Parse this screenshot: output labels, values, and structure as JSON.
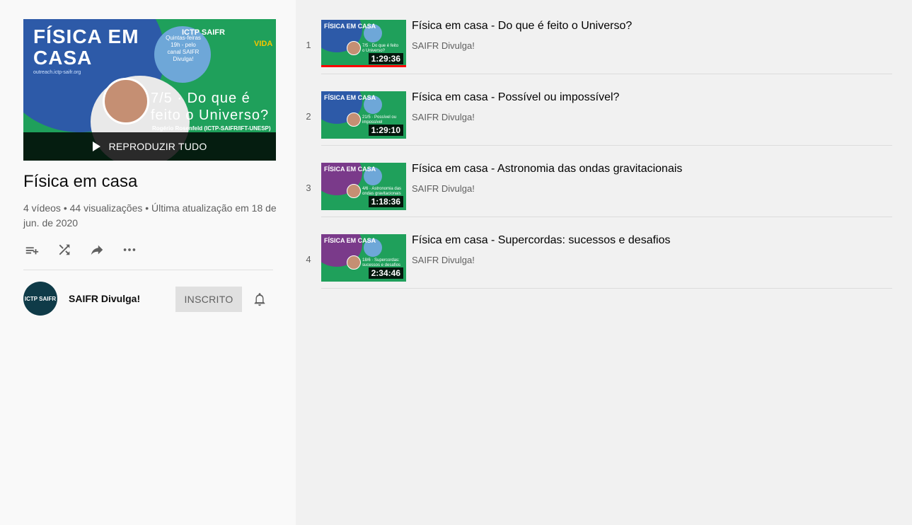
{
  "colors": {
    "accent_green": "#1fa05b",
    "blue": "#2d5aa8",
    "purple": "#7a3a8a",
    "progress_red": "#ff0000"
  },
  "hero": {
    "title_line1": "FÍSICA EM",
    "title_line2": "CASA",
    "url": "outreach.ictp-saifr.org",
    "badge": "Quintas-feiras 19h - pelo canal SAIFR Divulga!",
    "logo_text": "ICTP SAIFR",
    "logo2_text": "VIDA",
    "episode_line1": "7/5 · Do que é",
    "episode_line2": "feito o Universo?",
    "speaker": "Rogério Rosenfeld (ICTP-SAIFR/IFT-UNESP)",
    "play_all_label": "REPRODUZIR TUDO",
    "play_icon": "play-icon"
  },
  "playlist": {
    "title": "Física em casa",
    "videos_count": "4 vídeos",
    "views": "44 visualizações",
    "updated": "Última atualização em 18 de jun. de 2020",
    "actions": [
      {
        "icon": "add-to-queue-icon"
      },
      {
        "icon": "shuffle-icon"
      },
      {
        "icon": "share-icon"
      },
      {
        "icon": "more-icon"
      }
    ]
  },
  "owner": {
    "name": "SAIFR Divulga!",
    "avatar_text": "ICTP SAIFR",
    "subscribe_label": "INSCRITO",
    "bell_icon": "bell-icon"
  },
  "videos": [
    {
      "index": "1",
      "title": "Física em casa - Do que é feito o Universo?",
      "channel": "SAIFR Divulga!",
      "duration": "1:29:36",
      "thumb_title": "FÍSICA EM CASA",
      "thumb_episode": "7/5 · Do que é feito o Universo?",
      "thumb_color": "#2d5aa8",
      "watched": 1.0
    },
    {
      "index": "2",
      "title": "Física em casa - Possível ou impossível?",
      "channel": "SAIFR Divulga!",
      "duration": "1:29:10",
      "thumb_title": "FÍSICA EM CASA",
      "thumb_episode": "21/5 · Possível ou impossível",
      "thumb_color": "#2d5aa8",
      "watched": 0
    },
    {
      "index": "3",
      "title": "Física em casa - Astronomia das ondas gravitacionais",
      "channel": "SAIFR Divulga!",
      "duration": "1:18:36",
      "thumb_title": "FÍSICA EM CASA",
      "thumb_episode": "4/6 · Astronomia das ondas gravitacionais",
      "thumb_color": "#7a3a8a",
      "watched": 0
    },
    {
      "index": "4",
      "title": "Física em casa - Supercordas: sucessos e desafios",
      "channel": "SAIFR Divulga!",
      "duration": "2:34:46",
      "thumb_title": "FÍSICA EM CASA",
      "thumb_episode": "18/6 · Supercordas: sucessos e desafios",
      "thumb_color": "#7a3a8a",
      "watched": 0
    }
  ]
}
